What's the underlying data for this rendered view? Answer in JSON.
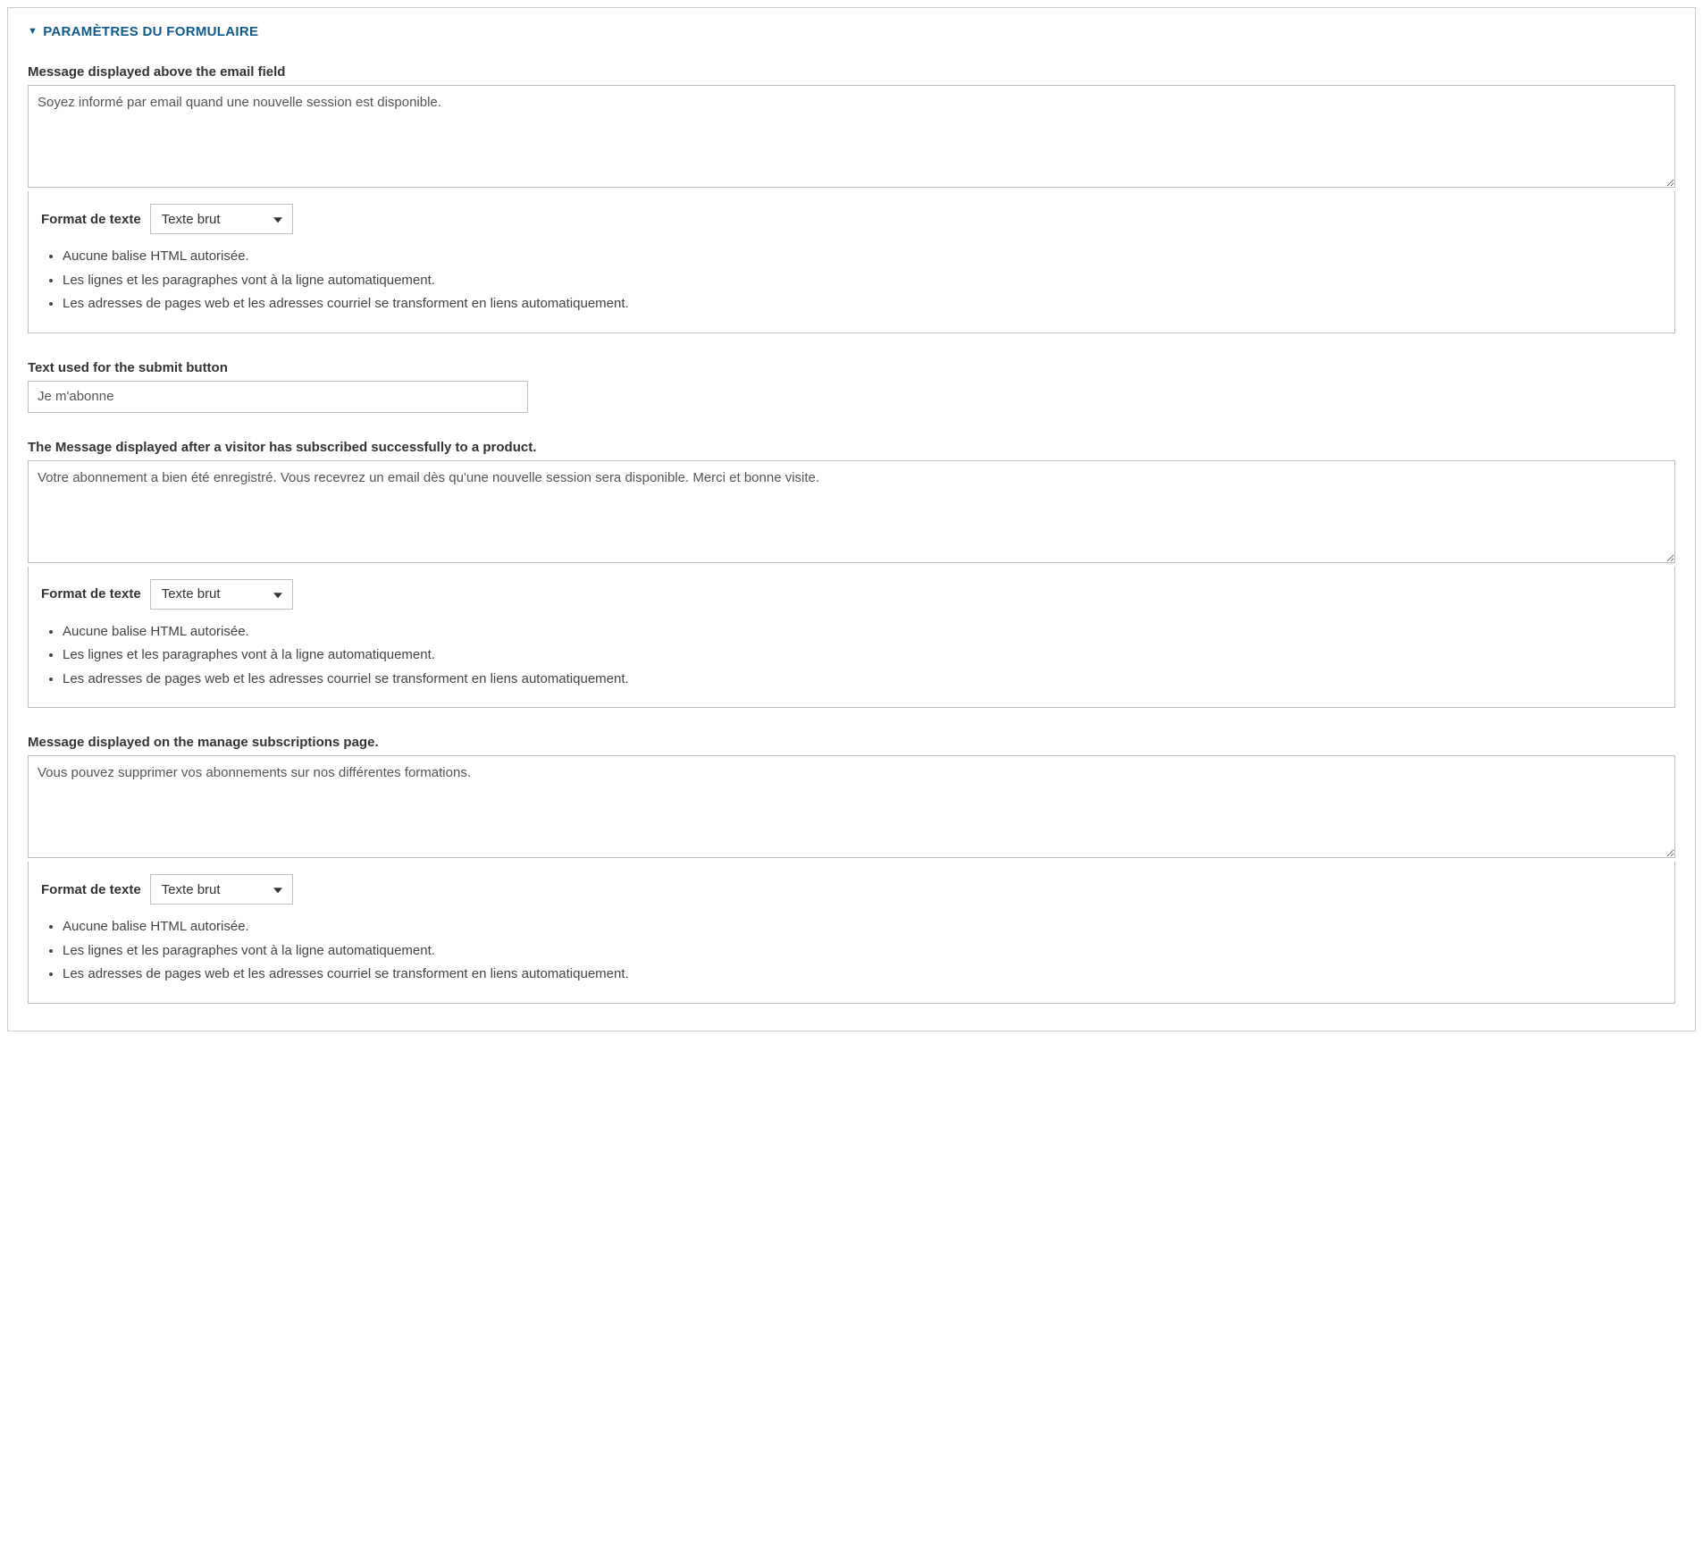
{
  "panel": {
    "title": "PARAMÈTRES DU FORMULAIRE"
  },
  "fields": {
    "above_email": {
      "label": "Message displayed above the email field",
      "value": "Soyez informé par email quand une nouvelle session est disponible."
    },
    "submit_text": {
      "label": "Text used for the submit button",
      "value": "Je m'abonne"
    },
    "success_msg": {
      "label": "The Message displayed after a visitor has subscribed successfully to a product.",
      "value": "Votre abonnement a bien été enregistré. Vous recevrez un email dès qu'une nouvelle session sera disponible. Merci et bonne visite."
    },
    "manage_msg": {
      "label": "Message displayed on the manage subscriptions page.",
      "value": "Vous pouvez supprimer vos abonnements sur nos différentes formations."
    }
  },
  "format": {
    "label": "Format de texte",
    "selected": "Texte brut",
    "hints": [
      "Aucune balise HTML autorisée.",
      "Les lignes et les paragraphes vont à la ligne automatiquement.",
      "Les adresses de pages web et les adresses courriel se transforment en liens automatiquement."
    ]
  }
}
